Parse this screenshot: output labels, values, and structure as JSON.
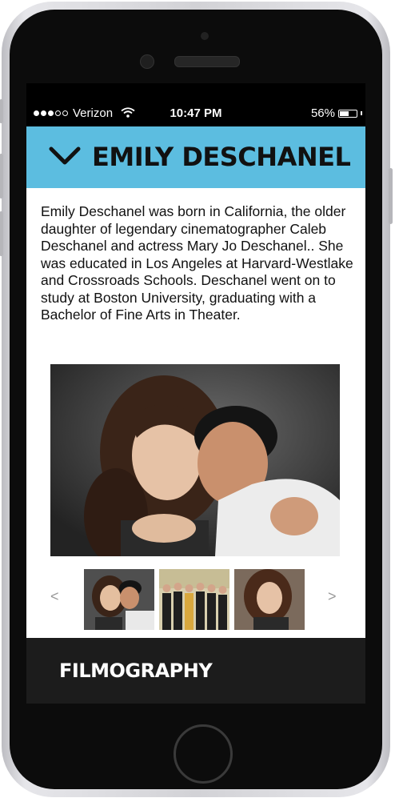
{
  "status_bar": {
    "carrier": "Verizon",
    "time": "10:47 PM",
    "battery_percent": "56%",
    "battery_level": 0.56,
    "signal_bars_filled": 3,
    "signal_bars_total": 5
  },
  "header": {
    "title": "EMILY DESCHANEL",
    "background_color": "#5cbde0",
    "icon": "chevron-down-icon"
  },
  "bio": {
    "text": "Emily Deschanel was born in California, the older daughter of legendary cinematographer Caleb Deschanel and actress Mary Jo Deschanel.. She was educated in Los Angeles at Harvard-Westlake and Crossroads Schools. Deschanel went on to study at Boston University, graduating with a Bachelor of Fine Arts in Theater."
  },
  "gallery": {
    "prev_label": "<",
    "next_label": ">",
    "thumbnail_count": 3
  },
  "footer": {
    "label": "FILMOGRAPHY",
    "background_color": "#1c1c1c"
  }
}
